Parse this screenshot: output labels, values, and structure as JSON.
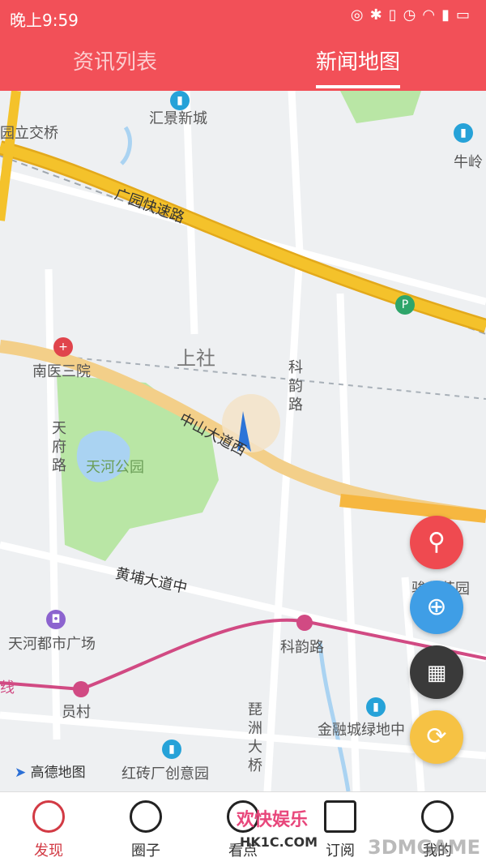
{
  "status_bar": {
    "time": "晚上9:59",
    "icons": [
      "alarm-icon",
      "bluetooth-icon",
      "vibrate-icon",
      "clock-icon",
      "wifi-icon",
      "signal-icon",
      "battery-icon"
    ]
  },
  "tabs": [
    {
      "label": "资讯列表",
      "active": false
    },
    {
      "label": "新闻地图",
      "active": true
    }
  ],
  "map": {
    "labels": {
      "huijing": "汇景新城",
      "liyuan_bridge": "园立交桥",
      "guangyuan_expressway": "广园快速路",
      "niuling": "牛岭",
      "shangshe": "上社",
      "nanyi": "南医三院",
      "keyun_road": "科韵路",
      "zhongshan_avenue": "中山大道西",
      "tianfu_road": "天府路",
      "tianhe_park": "天河公园",
      "huangpu_avenue": "黄埔大道中",
      "tianhe_mall": "天河都市广场",
      "keyun_station": "科韵路",
      "yuancun": "员村",
      "pipa_bridge": "琵洲大桥",
      "finance_green": "金融城绿地中",
      "hongzhuan": "红砖厂创意园",
      "partial_garden": "骏华花园",
      "line_edge": "线"
    },
    "attribution": "高德地图"
  },
  "fabs": [
    {
      "name": "search-fab-button",
      "icon": "search-icon",
      "color": "#ef4a50"
    },
    {
      "name": "locate-fab-button",
      "icon": "locate-icon",
      "color": "#3f9ee6"
    },
    {
      "name": "layers-fab-button",
      "icon": "grid-icon",
      "color": "#3a3a3a"
    },
    {
      "name": "refresh-fab-button",
      "icon": "refresh-icon",
      "color": "#f6c244"
    }
  ],
  "bottom_nav": [
    {
      "label": "发现",
      "icon": "discover-icon",
      "active": true
    },
    {
      "label": "圈子",
      "icon": "circle-icon",
      "active": false
    },
    {
      "label": "看点",
      "icon": "watch-icon",
      "active": false
    },
    {
      "label": "订阅",
      "icon": "subscribe-icon",
      "active": false
    },
    {
      "label": "我的",
      "icon": "profile-icon",
      "active": false
    }
  ],
  "watermarks": {
    "site_cn": "欢快娱乐",
    "site_url": "HK1C.COM",
    "brand": "3DMGAME"
  },
  "colors": {
    "brand_red": "#f25058",
    "expressway": "#f4c22b",
    "park": "#b9e6a5",
    "water": "#aad3f2",
    "metro": "#d14a83"
  }
}
